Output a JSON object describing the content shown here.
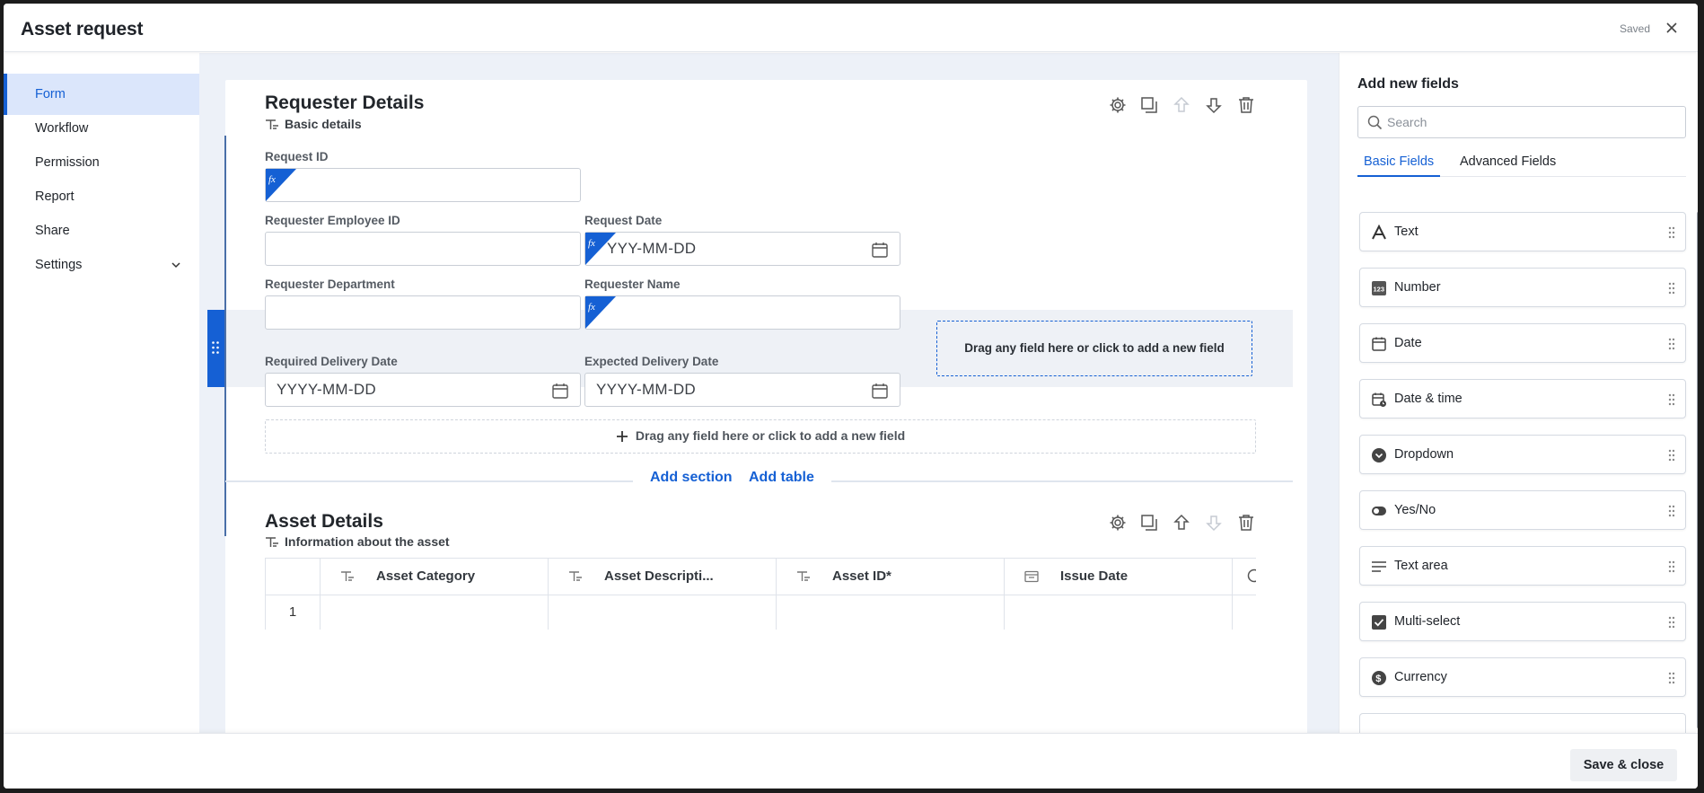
{
  "window": {
    "title": "Asset request",
    "status": "Saved"
  },
  "nav": {
    "items": [
      {
        "label": "Form",
        "active": true
      },
      {
        "label": "Workflow"
      },
      {
        "label": "Permission"
      },
      {
        "label": "Report"
      },
      {
        "label": "Share"
      },
      {
        "label": "Settings",
        "has_chevron": true
      }
    ]
  },
  "sections": [
    {
      "title": "Requester Details",
      "subtitle": "Basic details",
      "fields": {
        "request_id": {
          "label": "Request ID",
          "formula": true
        },
        "requester_employee_id": {
          "label": "Requester Employee ID"
        },
        "request_date": {
          "label": "Request Date",
          "formula": true,
          "placeholder": "YYY-MM-DD"
        },
        "requester_department": {
          "label": "Requester Department"
        },
        "requester_name": {
          "label": "Requester Name",
          "formula": true
        },
        "required_delivery_date": {
          "label": "Required Delivery Date",
          "placeholder": "YYYY-MM-DD"
        },
        "expected_delivery_date": {
          "label": "Expected Delivery Date",
          "placeholder": "YYYY-MM-DD"
        }
      },
      "drop_box_text": "Drag any field here or click to add a new field",
      "drop_wide_text": "Drag any field here or click to add a new field"
    },
    {
      "title": "Asset Details",
      "subtitle": "Information about the asset",
      "table": {
        "columns": [
          "Asset Category",
          "Asset Descripti...",
          "Asset ID*",
          "Issue Date"
        ],
        "rows": [
          {
            "index": "1"
          }
        ]
      }
    }
  ],
  "section_links": {
    "add_section": "Add section",
    "add_table": "Add table"
  },
  "right_panel": {
    "title": "Add new fields",
    "search_placeholder": "Search",
    "tabs": [
      {
        "label": "Basic Fields",
        "active": true
      },
      {
        "label": "Advanced Fields"
      }
    ],
    "fields": [
      {
        "label": "Text",
        "icon": "text-icon"
      },
      {
        "label": "Number",
        "icon": "number-icon"
      },
      {
        "label": "Date",
        "icon": "date-icon"
      },
      {
        "label": "Date & time",
        "icon": "datetime-icon"
      },
      {
        "label": "Dropdown",
        "icon": "dropdown-icon"
      },
      {
        "label": "Yes/No",
        "icon": "toggle-icon"
      },
      {
        "label": "Text area",
        "icon": "textarea-icon"
      },
      {
        "label": "Multi-select",
        "icon": "checkbox-icon"
      },
      {
        "label": "Currency",
        "icon": "currency-icon"
      }
    ]
  },
  "footer": {
    "save_label": "Save & close"
  },
  "colors": {
    "accent": "#1560d4",
    "canvas_bg": "#edf1f8",
    "nav_active_bg": "#dbe6fb"
  }
}
